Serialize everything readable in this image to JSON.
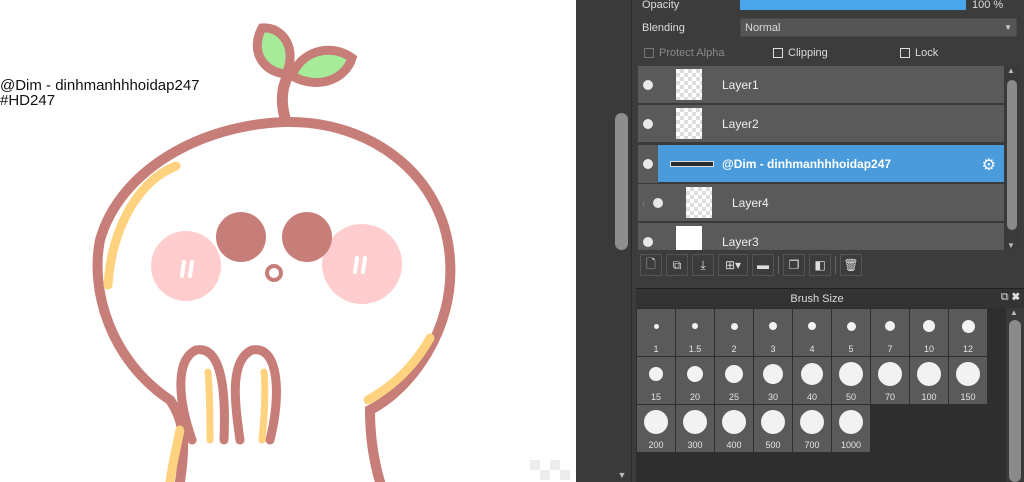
{
  "canvas": {
    "watermark_line1": "@Dim - dinhmanhhhoidap247",
    "watermark_line2": "#HD247"
  },
  "properties": {
    "opacity_label": "Opacity",
    "opacity_value": "100 %",
    "opacity_fraction": 1.0,
    "blending_label": "Blending",
    "blending_value": "Normal",
    "protect_alpha_label": "Protect Alpha",
    "clipping_label": "Clipping",
    "lock_label": "Lock"
  },
  "layers": [
    {
      "name": "Layer1",
      "selected": false
    },
    {
      "name": "Layer2",
      "selected": false
    },
    {
      "name": "@Dim - dinhmanhhhoidap247",
      "selected": true
    },
    {
      "name": "Layer4",
      "selected": false
    },
    {
      "name": "Layer3",
      "selected": false
    }
  ],
  "brush": {
    "title": "Brush Size",
    "sizes": [
      "1",
      "1.5",
      "2",
      "3",
      "4",
      "5",
      "7",
      "10",
      "12",
      "15",
      "20",
      "25",
      "30",
      "40",
      "50",
      "70",
      "100",
      "150",
      "200",
      "300",
      "400",
      "500",
      "700",
      "1000"
    ]
  },
  "colors": {
    "accent": "#4a9bdb",
    "outline": "#c77e78",
    "leaf": "#a6ec98",
    "blush": "#ffcdcd",
    "highlight": "#ffd27f"
  },
  "icons": [
    "new-layer-icon",
    "copy-layer-icon",
    "merge-icon",
    "add-layer-dropdown-icon",
    "folder-icon",
    "duplicate-icon",
    "mask-icon",
    "trash-icon",
    "gear-icon",
    "popout-icon",
    "close-icon"
  ]
}
